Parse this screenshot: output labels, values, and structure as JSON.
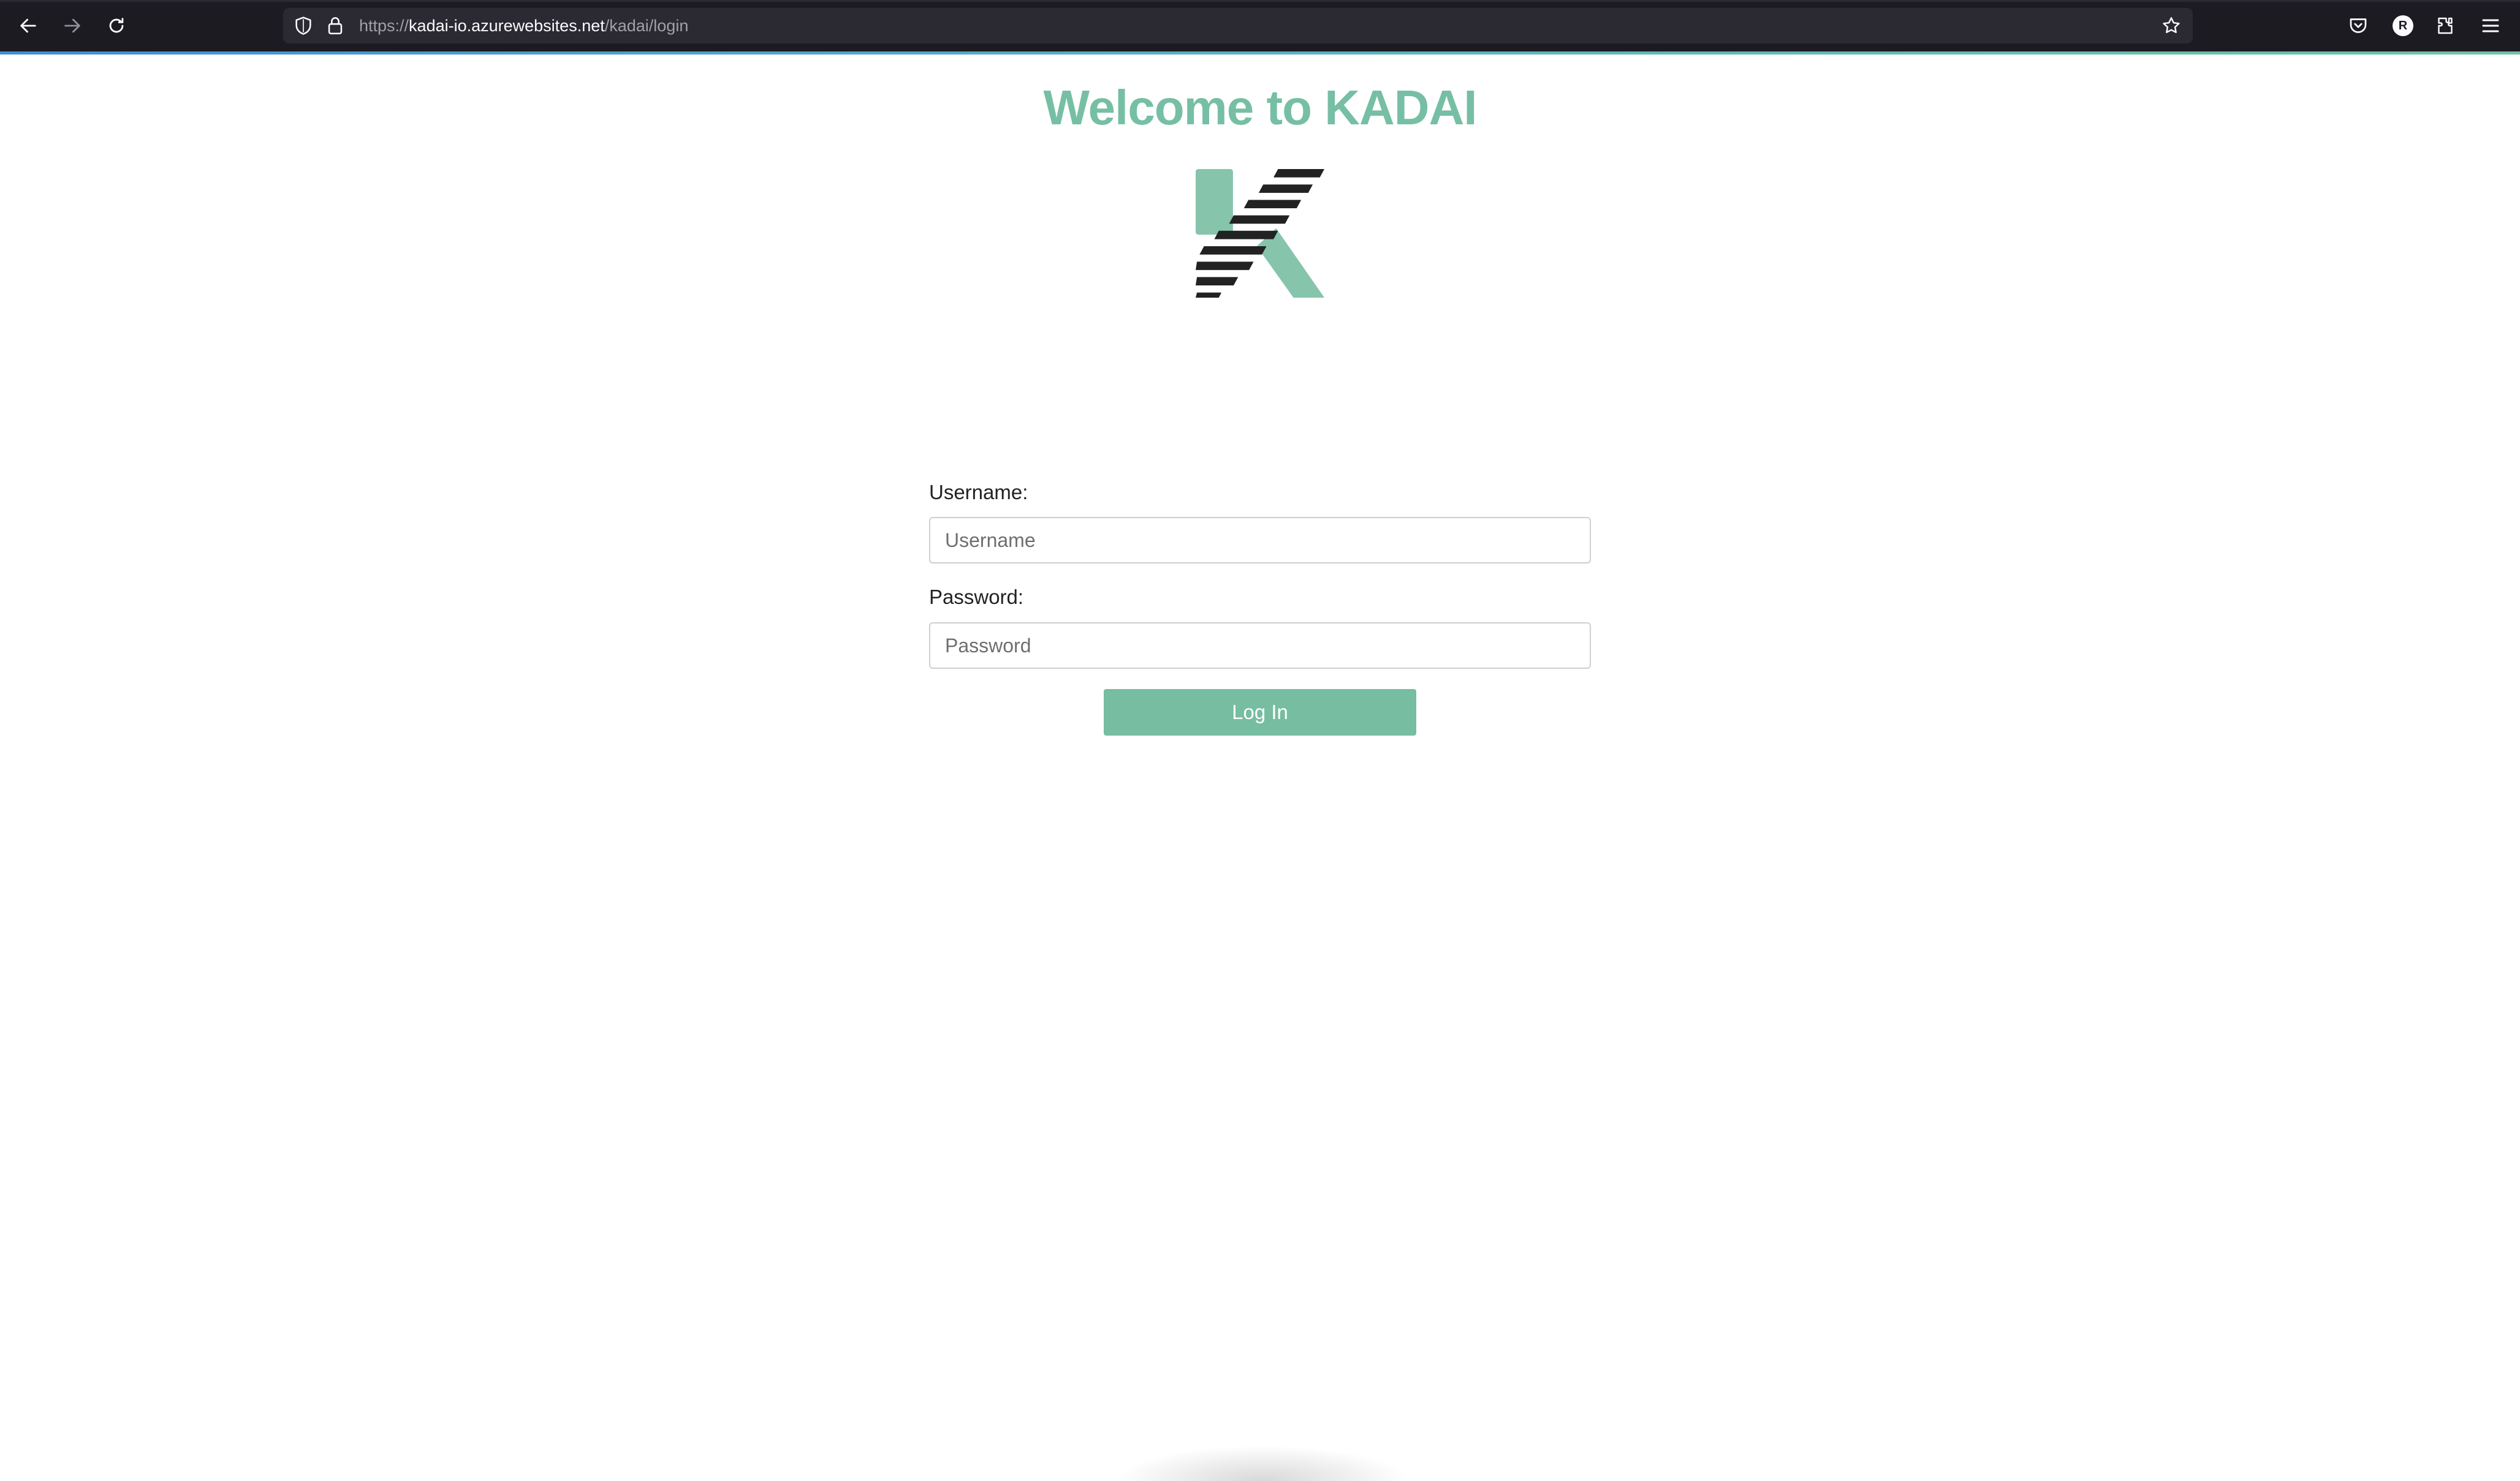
{
  "browser": {
    "url_scheme": "https://",
    "url_host": "kadai-io.azurewebsites.net",
    "url_path": "/kadai/login",
    "profile_initial": "R",
    "icons": [
      "back-arrow-icon",
      "forward-arrow-icon",
      "reload-icon",
      "shield-icon",
      "lock-icon",
      "star-icon",
      "pocket-icon",
      "extensions-icon",
      "menu-icon"
    ]
  },
  "page": {
    "title": "Welcome to KADAI",
    "logo": "kadai-logo",
    "accent_color": "#76bfa4"
  },
  "form": {
    "username_label": "Username:",
    "username_placeholder": "Username",
    "username_value": "",
    "password_label": "Password:",
    "password_placeholder": "Password",
    "password_value": "",
    "login_label": "Log In"
  }
}
